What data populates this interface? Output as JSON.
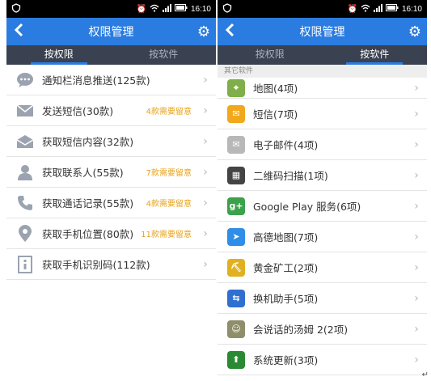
{
  "status": {
    "time": "16:10"
  },
  "left": {
    "title": "权限管理",
    "tabs": [
      {
        "label": "按权限",
        "active": true
      },
      {
        "label": "按软件",
        "active": false
      }
    ],
    "items": [
      {
        "label": "通知栏消息推送(125款)",
        "note": "",
        "icon": "chat-bubble-icon"
      },
      {
        "label": "发送短信(30款)",
        "note": "4款需要留意",
        "icon": "envelope-icon"
      },
      {
        "label": "获取短信内容(32款)",
        "note": "",
        "icon": "envelope-open-icon"
      },
      {
        "label": "获取联系人(55款)",
        "note": "7款需要留意",
        "icon": "person-icon"
      },
      {
        "label": "获取通话记录(55款)",
        "note": "4款需要留意",
        "icon": "phone-icon"
      },
      {
        "label": "获取手机位置(80款)",
        "note": "11款需要留意",
        "icon": "location-pin-icon"
      },
      {
        "label": "获取手机识别码(112款)",
        "note": "",
        "icon": "id-card-icon"
      }
    ]
  },
  "right": {
    "title": "权限管理",
    "tabs": [
      {
        "label": "按权限",
        "active": false
      },
      {
        "label": "按软件",
        "active": true
      }
    ],
    "section": "其它软件",
    "items": [
      {
        "label": "地图(4项)",
        "icon": "maps-app-icon",
        "color": "#7fae4a"
      },
      {
        "label": "短信(7项)",
        "icon": "sms-app-icon",
        "color": "#f2a81d"
      },
      {
        "label": "电子邮件(4项)",
        "icon": "email-app-icon",
        "color": "#b8b8b8"
      },
      {
        "label": "二维码扫描(1项)",
        "icon": "qr-scan-app-icon",
        "color": "#444444"
      },
      {
        "label": "Google Play 服务(6项)",
        "icon": "google-play-services-icon",
        "color": "#3ba14b"
      },
      {
        "label": "高德地图(7项)",
        "icon": "amap-app-icon",
        "color": "#2e8ee8"
      },
      {
        "label": "黄金矿工(2项)",
        "icon": "gold-miner-app-icon",
        "color": "#e0b020"
      },
      {
        "label": "换机助手(5项)",
        "icon": "phone-switch-app-icon",
        "color": "#2f6fd0"
      },
      {
        "label": "会说话的汤姆 2(2项)",
        "icon": "talking-tom-app-icon",
        "color": "#8e8e6a"
      },
      {
        "label": "系统更新(3项)",
        "icon": "system-update-app-icon",
        "color": "#2a8a34"
      }
    ]
  },
  "colors": {
    "accent": "#2b7ce0",
    "tabbar": "#3a4150",
    "warn": "#e8a21a"
  }
}
